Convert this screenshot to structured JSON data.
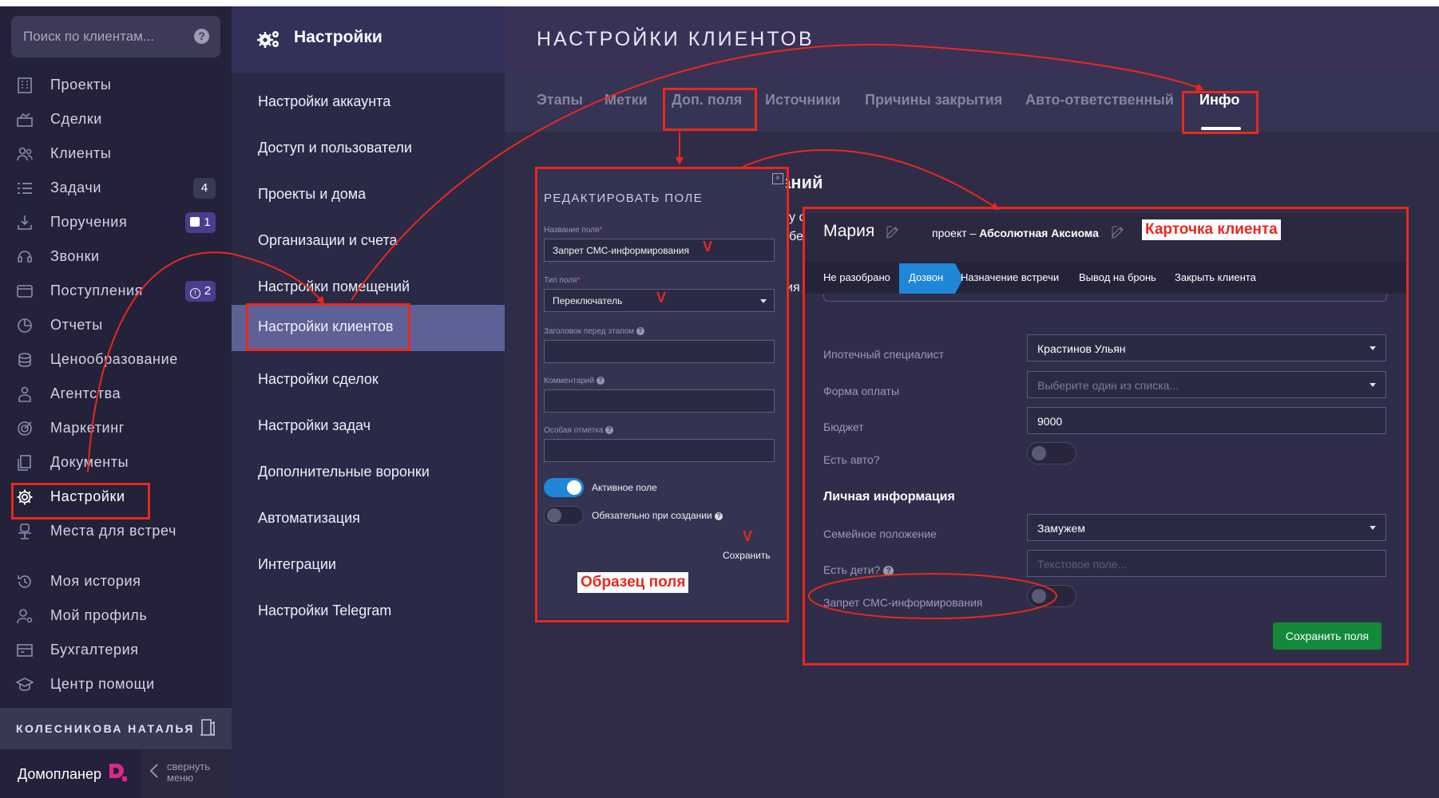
{
  "sidebar": {
    "search_placeholder": "Поиск по клиентам...",
    "items": [
      {
        "label": "Проекты",
        "icon": "building-icon"
      },
      {
        "label": "Сделки",
        "icon": "deals-icon"
      },
      {
        "label": "Клиенты",
        "icon": "users-icon"
      },
      {
        "label": "Задачи",
        "icon": "tasks-icon",
        "badge": "4"
      },
      {
        "label": "Поручения",
        "icon": "assignments-icon",
        "badge": "1"
      },
      {
        "label": "Звонки",
        "icon": "calls-icon"
      },
      {
        "label": "Поступления",
        "icon": "income-icon",
        "badge": "2"
      },
      {
        "label": "Отчеты",
        "icon": "reports-icon"
      },
      {
        "label": "Ценообразование",
        "icon": "pricing-icon"
      },
      {
        "label": "Агентства",
        "icon": "agency-icon"
      },
      {
        "label": "Маркетинг",
        "icon": "marketing-icon"
      },
      {
        "label": "Документы",
        "icon": "documents-icon"
      },
      {
        "label": "Настройки",
        "icon": "gear-icon"
      },
      {
        "label": "Места для встреч",
        "icon": "meeting-place-icon"
      },
      {
        "label": "Моя история",
        "icon": "history-icon"
      },
      {
        "label": "Мой профиль",
        "icon": "profile-icon"
      },
      {
        "label": "Бухгалтерия",
        "icon": "accounting-icon"
      },
      {
        "label": "Центр помощи",
        "icon": "help-center-icon"
      }
    ],
    "user_name": "КОЛЕСНИКОВА НАТАЛЬЯ",
    "logo": "Домопланер",
    "collapse_line1": "свернуть",
    "collapse_line2": "меню"
  },
  "settings_menu": {
    "title": "Настройки",
    "items": [
      "Настройки аккаунта",
      "Доступ и пользователи",
      "Проекты и дома",
      "Организации и счета",
      "Настройки помещений",
      "Настройки клиентов",
      "Настройки сделок",
      "Настройки задач",
      "Дополнительные воронки",
      "Автоматизация",
      "Интеграции",
      "Настройки Telegram"
    ],
    "active_index": 5
  },
  "main": {
    "title": "НАСТРОЙКИ КЛИЕНТОВ",
    "tabs": [
      "Этапы",
      "Метки",
      "Доп. поля",
      "Источники",
      "Причины закрытия",
      "Авто-ответственный",
      "Инфо"
    ],
    "active_tab": "Инфо",
    "behind_heading_fragment": "аний",
    "behind_fragment_1": "у с",
    "behind_fragment_2": "бе",
    "behind_fragment_3": "ия"
  },
  "edit_field": {
    "title": "РЕДАКТИРОВАТЬ ПОЛЕ",
    "close": "×",
    "name_label": "Название поля",
    "name_value": "Запрет СМС-информирования",
    "type_label": "Тип поля",
    "type_value": "Переключатель",
    "header_label": "Заголовок перед этапом",
    "comment_label": "Комментарий",
    "mark_label": "Особая отметка",
    "active_label": "Активное поле",
    "active_on": true,
    "required_label": "Обязательно при создании",
    "required_on": false,
    "save_label": "Сохранить",
    "required_star": "*",
    "help_mark": "?"
  },
  "client_card": {
    "name": "Мария",
    "project_prefix": "проект –",
    "project_name": "Абсолютная Аксиома",
    "stages": [
      "Не разобрано",
      "Дозвон",
      "Назначение встречи",
      "Вывод на бронь",
      "Закрыть клиента"
    ],
    "active_stage": "Дозвон",
    "fields": [
      {
        "label": "Ипотечный специалист",
        "value": "Крастинов Ульян",
        "type": "select"
      },
      {
        "label": "Форма оплаты",
        "placeholder": "Выберите один из списка...",
        "type": "select"
      },
      {
        "label": "Бюджет",
        "value": "9000",
        "type": "input"
      },
      {
        "label": "Есть авто?",
        "type": "toggle",
        "on": false
      }
    ],
    "section_title": "Личная информация",
    "personal_fields": [
      {
        "label": "Семейное положение",
        "value": "Замужем",
        "type": "select"
      },
      {
        "label": "Есть дети?",
        "placeholder": "Текстовое поле...",
        "type": "input"
      },
      {
        "label": "Запрет СМС-информирования",
        "type": "toggle",
        "on": false
      }
    ],
    "save_label": "Сохранить поля"
  },
  "annotations": {
    "field_sample_label": "Образец поля",
    "client_card_label": "Карточка клиента",
    "check_mark": "V"
  },
  "colors": {
    "annotation_red": "#e8291c",
    "active_stage_blue": "#1f86d9",
    "toggle_blue": "#1f86d9",
    "save_green": "#138a3a"
  }
}
